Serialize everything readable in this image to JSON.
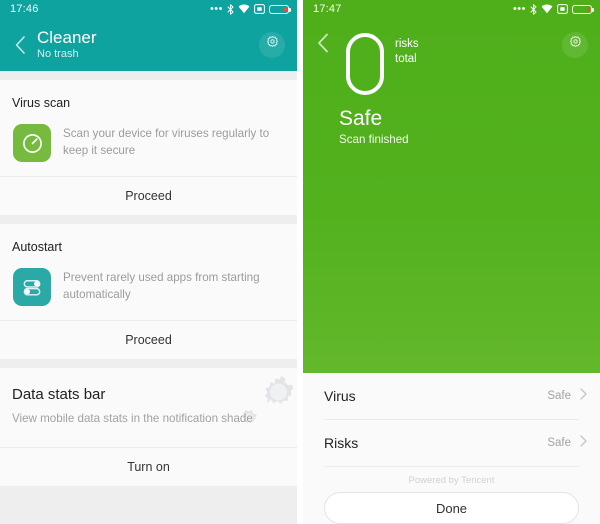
{
  "left_screen": {
    "status_bar": {
      "time": "17:46",
      "icons": [
        "more-dots-icon",
        "bluetooth-icon",
        "wifi-icon",
        "sim-card-icon",
        "battery-icon"
      ]
    },
    "header": {
      "back_icon": "back-chevron-icon",
      "title": "Cleaner",
      "subtitle": "No trash",
      "settings_icon": "gear-icon"
    },
    "sections": [
      {
        "title": "Virus scan",
        "icon": "virus-scan-icon",
        "description": "Scan your device for viruses regularly to keep it secure",
        "action": "Proceed"
      },
      {
        "title": "Autostart",
        "icon": "autostart-toggles-icon",
        "description": "Prevent rarely used apps from starting automatically",
        "action": "Proceed"
      }
    ],
    "data_stats": {
      "title": "Data stats bar",
      "description": "View mobile data stats in the notification shade",
      "action": "Turn on",
      "decoration_icon": "gears-decoration-icon"
    }
  },
  "right_screen": {
    "status_bar": {
      "time": "17:47",
      "icons": [
        "more-dots-icon",
        "bluetooth-icon",
        "wifi-icon",
        "sim-card-icon",
        "battery-icon"
      ]
    },
    "header": {
      "back_icon": "back-chevron-icon",
      "settings_icon": "gear-icon",
      "count": "0",
      "count_label_line1": "risks",
      "count_label_line2": "total",
      "status_title": "Safe",
      "status_subtitle": "Scan finished"
    },
    "results": [
      {
        "label": "Virus",
        "value": "Safe",
        "chevron": "chevron-right-icon"
      },
      {
        "label": "Risks",
        "value": "Safe",
        "chevron": "chevron-right-icon"
      }
    ],
    "powered_by": "Powered by Tencent",
    "done_button": "Done"
  },
  "colors": {
    "teal_header": "#0fa3a0",
    "green_panel": "#4faf1b",
    "green_panel_bottom": "#63b82b",
    "icon_green": "#76bb3f",
    "icon_teal": "#2aa9a6",
    "page_bg": "#fafafa",
    "gap_bg": "#eeeeee"
  }
}
